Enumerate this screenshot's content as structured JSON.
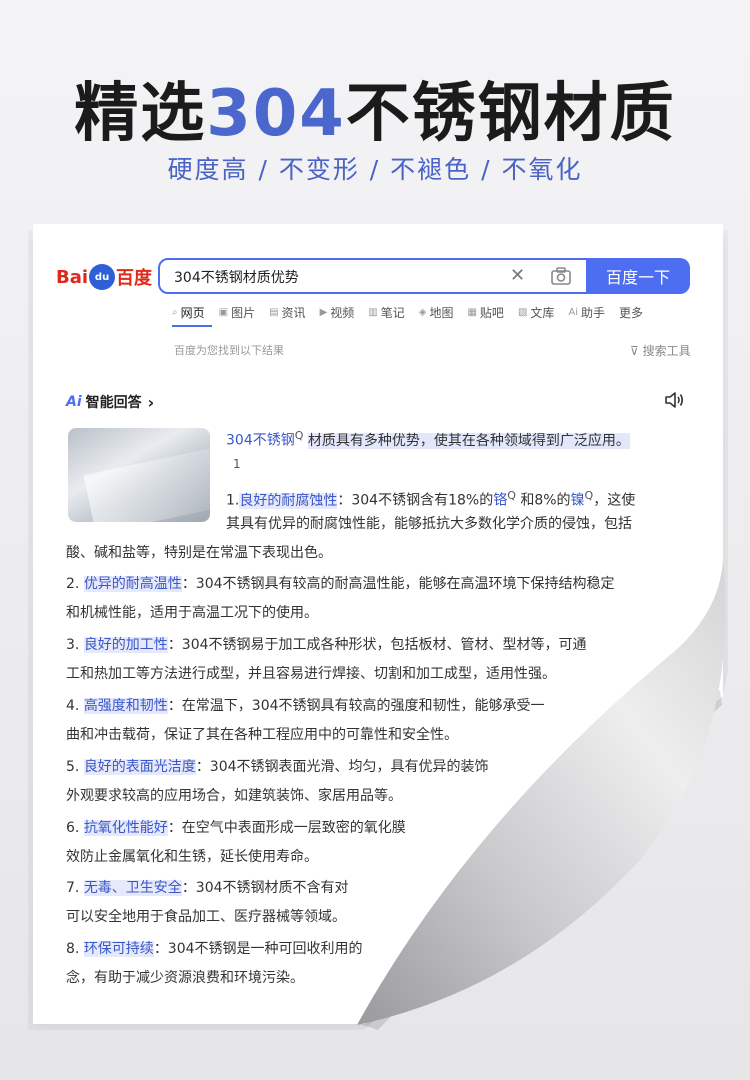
{
  "headline": {
    "pre": "精选",
    "accent": "304",
    "post": "不锈钢材质"
  },
  "subline": "硬度高 / 不变形 / 不褪色 / 不氧化",
  "logo": {
    "part1": "Bai",
    "paw": "du",
    "part2": "百度"
  },
  "search": {
    "query": "304不锈钢材质优势",
    "clear": "✕",
    "button": "百度一下"
  },
  "tabs": [
    {
      "icon": "⌕",
      "label": "网页",
      "active": true
    },
    {
      "icon": "▣",
      "label": "图片"
    },
    {
      "icon": "▤",
      "label": "资讯"
    },
    {
      "icon": "▶",
      "label": "视频"
    },
    {
      "icon": "▥",
      "label": "笔记"
    },
    {
      "icon": "◈",
      "label": "地图"
    },
    {
      "icon": "▦",
      "label": "贴吧"
    },
    {
      "icon": "▧",
      "label": "文库"
    },
    {
      "icon": "Ai",
      "label": "助手"
    },
    {
      "icon": "",
      "label": "更多"
    }
  ],
  "result_note": "百度为您找到以下结果",
  "tools": "搜索工具",
  "ai": {
    "mark": "Ai",
    "title": "智能回答",
    "chevron": "›"
  },
  "intro": {
    "link": "304不锈钢",
    "ref": "Q",
    "text": "材质具有多种优势，使其在各种领域得到广泛应用。"
  },
  "note_number": "1",
  "items": [
    {
      "num": "1.",
      "label": "良好的耐腐蚀性",
      "line1a": "：304不锈钢含有18%的",
      "link1": "铬",
      "line1b": " 和8%的",
      "link2": "镍",
      "line1c": "，这使",
      "line2": "其具有优异的耐腐蚀性能，能够抵抗大多数化学介质的侵蚀，包括",
      "line3": "酸、碱和盐等，特别是在常温下表现出色。"
    },
    {
      "num": "2.",
      "label": "优异的耐高温性",
      "line1": "：304不锈钢具有较高的耐高温性能，能够在高温环境下保持结构稳定",
      "line2": "和机械性能，适用于高温工况下的使用。"
    },
    {
      "num": "3.",
      "label": "良好的加工性",
      "line1": "：304不锈钢易于加工成各种形状，包括板材、管材、型材等，可通",
      "line2": "工和热加工等方法进行成型，并且容易进行焊接、切割和加工成型，适用性强。"
    },
    {
      "num": "4.",
      "label": "高强度和韧性",
      "line1": "：在常温下，304不锈钢具有较高的强度和韧性，能够承受一",
      "line2": "曲和冲击载荷，保证了其在各种工程应用中的可靠性和安全性。"
    },
    {
      "num": "5.",
      "label": "良好的表面光洁度",
      "line1": "：304不锈钢表面光滑、均匀，具有优异的装饰",
      "line2": "外观要求较高的应用场合，如建筑装饰、家居用品等。"
    },
    {
      "num": "6.",
      "label": "抗氧化性能好",
      "line1": "：在空气中表面形成一层致密的氧化膜",
      "line2": "效防止金属氧化和生锈，延长使用寿命。"
    },
    {
      "num": "7.",
      "label": "无毒、卫生安全",
      "line1": "：304不锈钢材质不含有对",
      "line2": "可以安全地用于食品加工、医疗器械等领域。"
    },
    {
      "num": "8.",
      "label": "环保可持续",
      "line1": "：304不锈钢是一种可回收利用的",
      "line2": "念，有助于减少资源浪费和环境污染。"
    }
  ]
}
